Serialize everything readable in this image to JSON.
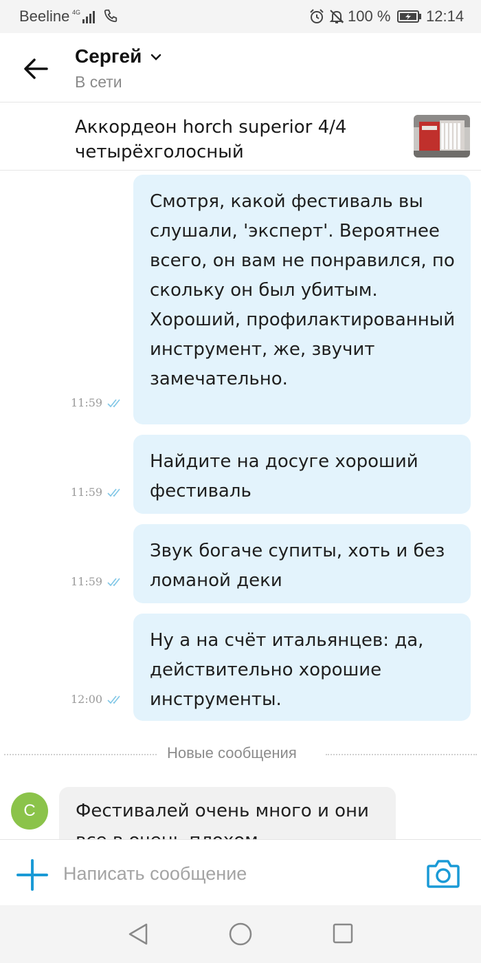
{
  "status_bar": {
    "carrier": "Beeline",
    "network": "4G",
    "battery_percent": "100 %",
    "time": "12:14"
  },
  "header": {
    "name": "Сергей",
    "status": "В сети"
  },
  "listing": {
    "title": "Аккордеон horch superior 4/4 четырёхголосный"
  },
  "messages": [
    {
      "text": "Смотря, какой фестиваль вы слушали, 'эксперт'. Вероятнее всего, он вам не понравился, по скольку он был убитым. Хороший, профилактированный инструмент, же, звучит замечательно.",
      "time": "11:59",
      "read": true
    },
    {
      "text": "Найдите на досуге хороший фестиваль",
      "time": "11:59",
      "read": true
    },
    {
      "text": "Звук богаче супиты, хоть и без ломаной деки",
      "time": "11:59",
      "read": true
    },
    {
      "text": "Ну а на счёт итальянцев:  да, действительно хорошие инструменты.",
      "time": "12:00",
      "read": true
    }
  ],
  "divider": {
    "label": "Новые сообщения"
  },
  "incoming": {
    "avatar_letter": "C",
    "avatar_color": "#8bc34a",
    "text": "Фестивалей очень много и они все в очень плохом"
  },
  "composer": {
    "placeholder": "Написать сообщение"
  },
  "colors": {
    "accent": "#1a9ad6",
    "outgoing_bubble": "#e3f3fc",
    "incoming_bubble": "#f1f1f1",
    "read_ticks": "#7fc6e6"
  },
  "icons": {
    "back": "arrow-left-icon",
    "plus": "plus-icon",
    "camera": "camera-icon",
    "nav_back": "triangle-back-icon",
    "nav_home": "circle-home-icon",
    "nav_recent": "square-recent-icon"
  }
}
